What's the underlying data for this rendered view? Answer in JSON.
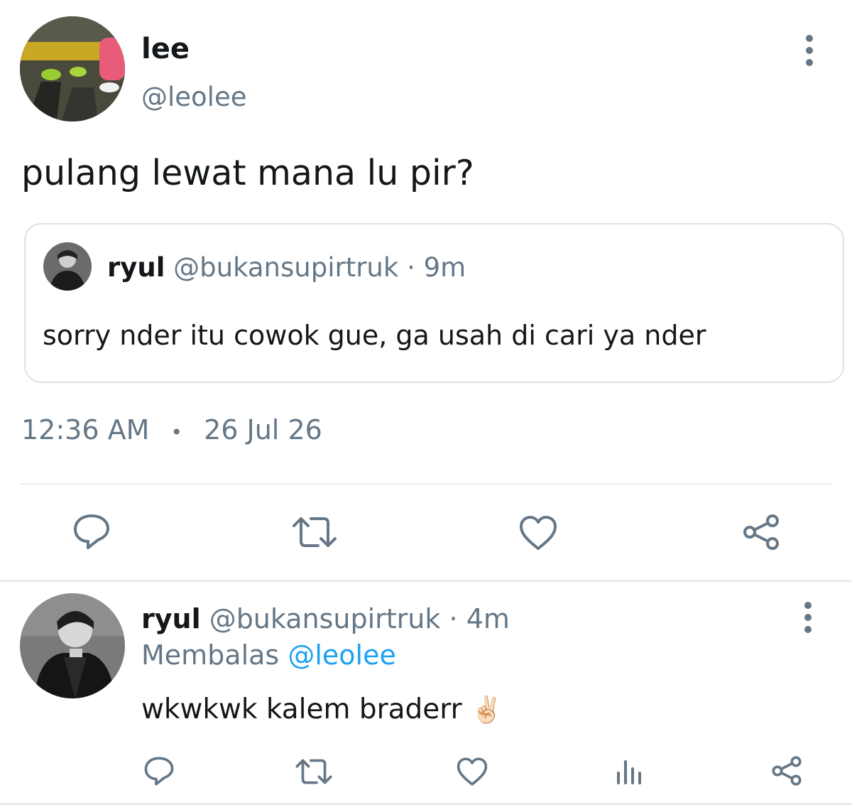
{
  "tweet": {
    "author_name": "lee",
    "author_handle": "@leolee",
    "text": "pulang lewat mana lu pir?",
    "quote": {
      "name": "ryul",
      "handle": "@bukansupirtruk",
      "sep": "·",
      "age": "9m",
      "text": "sorry nder itu cowok gue, ga usah di cari ya nder"
    },
    "time": "12:36 AM",
    "date_sep": "•",
    "date": "26 Jul 26",
    "actions": [
      "reply-icon",
      "retweet-icon",
      "like-icon",
      "share-icon"
    ]
  },
  "reply": {
    "name": "ryul",
    "handle": "@bukansupirtruk",
    "sep": "·",
    "age": "4m",
    "replying_prefix": "Membalas",
    "replying_to": "@leolee",
    "text": "wkwkwk kalem braderr",
    "emoji": "✌🏻",
    "actions": [
      "reply-icon",
      "retweet-icon",
      "like-icon",
      "analytics-icon",
      "share-icon"
    ]
  },
  "colors": {
    "gray": "#657786",
    "blue": "#1da1f2",
    "text": "#14171a",
    "divider": "#e6ecf0"
  }
}
